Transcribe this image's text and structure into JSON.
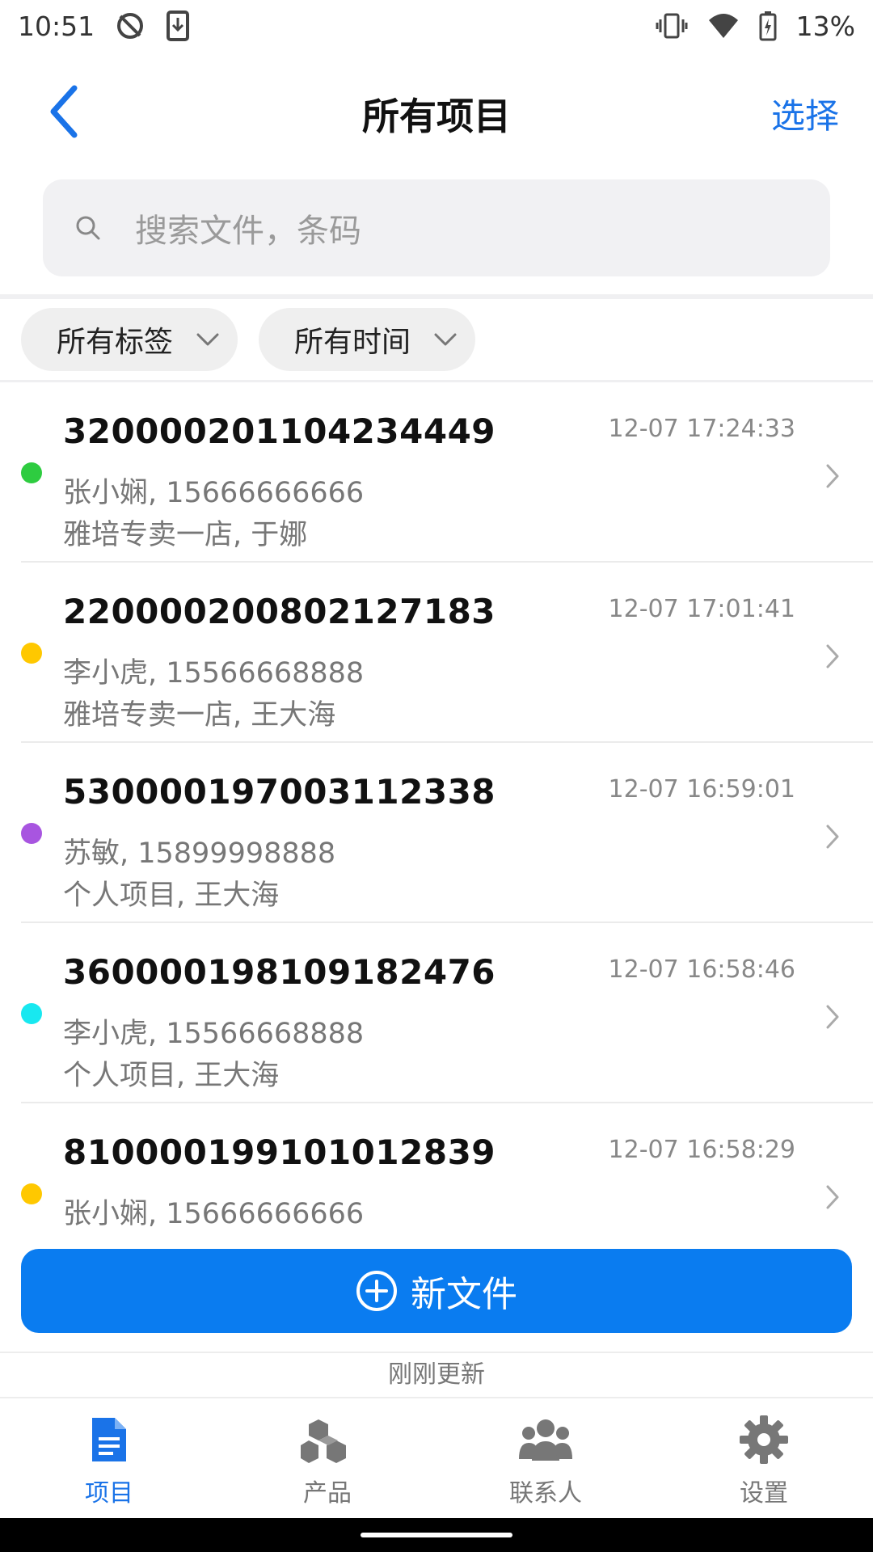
{
  "status_bar": {
    "time": "10:51",
    "battery": "13%",
    "icons": [
      "sync-off-icon",
      "download-icon",
      "vibrate-icon",
      "wifi-icon",
      "battery-charging-icon"
    ]
  },
  "header": {
    "title": "所有项目",
    "select_label": "选择",
    "back_icon": "chevron-left-icon"
  },
  "search": {
    "placeholder": "搜索文件，条码"
  },
  "filters": [
    {
      "label": "所有标签"
    },
    {
      "label": "所有时间"
    }
  ],
  "items": [
    {
      "code": "320000201104234449",
      "time": "12-07 17:24:33",
      "line1": "张小娴, 15666666666",
      "line2": "雅培专卖一店, 于娜",
      "dot_color": "#2ecc40"
    },
    {
      "code": "220000200802127183",
      "time": "12-07 17:01:41",
      "line1": "李小虎, 15566668888",
      "line2": "雅培专卖一店, 王大海",
      "dot_color": "#ffc800"
    },
    {
      "code": "530000197003112338",
      "time": "12-07 16:59:01",
      "line1": "苏敏, 15899998888",
      "line2": "个人项目, 王大海",
      "dot_color": "#a855e0"
    },
    {
      "code": "360000198109182476",
      "time": "12-07 16:58:46",
      "line1": "李小虎, 15566668888",
      "line2": "个人项目, 王大海",
      "dot_color": "#18e8f0"
    },
    {
      "code": "810000199101012839",
      "time": "12-07 16:58:29",
      "line1": "张小娴, 15666666666",
      "line2": "",
      "dot_color": "#ffc800"
    }
  ],
  "new_button": {
    "label": "新文件"
  },
  "update_status": "刚刚更新",
  "tabs": [
    {
      "label": "项目",
      "icon": "document-icon",
      "active": true
    },
    {
      "label": "产品",
      "icon": "boxes-icon",
      "active": false
    },
    {
      "label": "联系人",
      "icon": "people-icon",
      "active": false
    },
    {
      "label": "设置",
      "icon": "gear-icon",
      "active": false
    }
  ],
  "colors": {
    "accent": "#1a73e8",
    "button": "#0a7cf0"
  }
}
